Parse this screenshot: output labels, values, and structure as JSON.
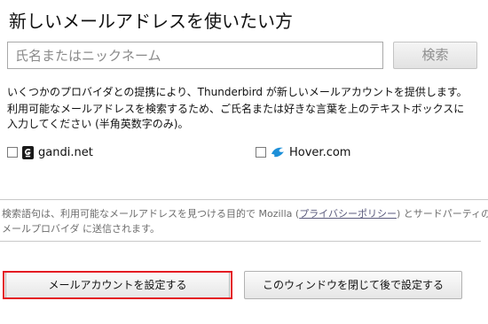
{
  "title": "新しいメールアドレスを使いたい方",
  "search": {
    "placeholder": "氏名またはニックネーム",
    "button_label": "検索"
  },
  "description": {
    "line1": "いくつかのプロバイダとの提携により、Thunderbird が新しいメールアカウントを提供します。",
    "line2": "利用可能なメールアドレスを検索するため、ご氏名または好きな言葉を上のテキストボックスに",
    "line3": "入力してください (半角英数字のみ)。"
  },
  "providers": [
    {
      "name": "gandi.net",
      "icon": "gandi-icon",
      "checked": false
    },
    {
      "name": "Hover.com",
      "icon": "hover-icon",
      "checked": false
    }
  ],
  "privacy": {
    "line1_prefix": "検索語句は、利用可能なメールアドレスを見つける目的で Mozilla (",
    "link_label": "プライバシーポリシー",
    "line1_suffix": ") とサードパーティの",
    "line2": "メールプロバイダ に送信されます。"
  },
  "buttons": {
    "setup_existing": "メールアカウントを設定する",
    "close_later": "このウィンドウを閉じて後で設定する"
  },
  "colors": {
    "highlight": "#e41b23",
    "hover_icon": "#1d8fd8"
  }
}
